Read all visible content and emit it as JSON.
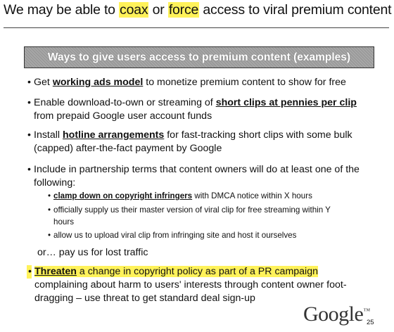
{
  "title": {
    "part1": "We may be able to ",
    "highlight1": "coax",
    "part2": " or ",
    "highlight2": "force",
    "part3": " access to viral premium content"
  },
  "banner": "Ways to give users access to premium content (examples)",
  "bullets": [
    {
      "pre": "Get ",
      "emph": "working ads model",
      "post": " to monetize premium content to show for free"
    },
    {
      "pre": "Enable download-to-own or streaming of ",
      "emph": "short clips at pennies per clip",
      "line2": "from prepaid Google user account funds"
    },
    {
      "pre": "Install ",
      "emph": "hotline arrangements",
      "post": " for fast-tracking short clips with some bulk",
      "line2": "(capped) after-the-fact payment by Google"
    },
    {
      "line1": "Include in partnership terms that content owners will do at least one of the",
      "line2": "following:"
    }
  ],
  "sub_bullets": [
    {
      "emph": "clamp down on copyright infringers",
      "post": " with DMCA notice within X hours"
    },
    {
      "line1": "officially supply us their master version of viral clip for free streaming within Y",
      "line2": "hours"
    },
    {
      "line1": "allow us to upload viral clip from infringing site and host it ourselves"
    }
  ],
  "or_line": "or… pay us for lost traffic",
  "threaten": {
    "emph": "Threaten",
    "post": " a change in copyright policy as part of a PR campaign",
    "line2": "complaining about harm to users' interests through content owner foot-",
    "line3": "dragging – use threat to get standard deal sign-up"
  },
  "logo": "Google",
  "logo_tm": "™",
  "page_number": "25",
  "colors": {
    "highlight": "#fff25a",
    "banner_bg": "#9a9a9a"
  }
}
